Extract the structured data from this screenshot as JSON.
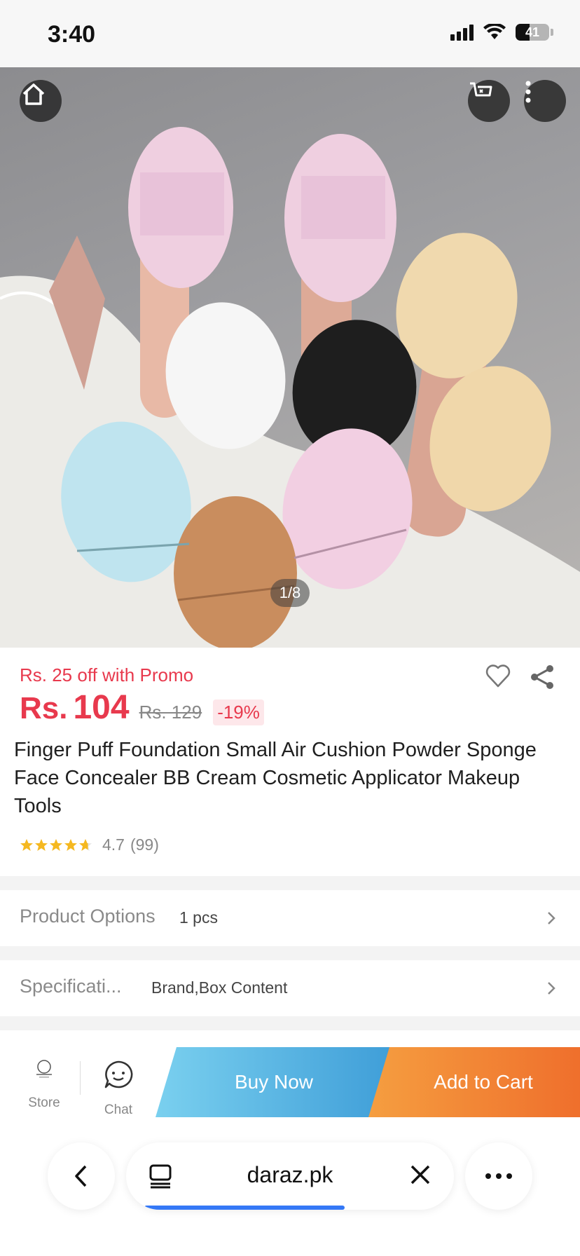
{
  "status_bar": {
    "time": "3:40",
    "battery": "41",
    "battery_level": 0.41
  },
  "product": {
    "image_counter": "1/8",
    "promo": "Rs. 25 off with Promo",
    "price_currency": "Rs.",
    "price": "104",
    "original_price": "Rs. 129",
    "discount": "-19%",
    "title": "Finger Puff Foundation Small Air Cushion Powder Sponge Face Concealer BB Cream Cosmetic Applicator Makeup Tools",
    "rating": 4.7,
    "rating_label": "4.7",
    "review_count": "(99)"
  },
  "options": {
    "label": "Product Options",
    "value": "1 pcs"
  },
  "specifications": {
    "label": "Specificati...",
    "value": "Brand,Box Content"
  },
  "action_bar": {
    "store_label": "Store",
    "chat_label": "Chat",
    "buy_now": "Buy Now",
    "add_to_cart": "Add to Cart"
  },
  "browser": {
    "host": "daraz.pk"
  },
  "colors": {
    "accent_red": "#e8394d",
    "buy_now_blue": "#3f9ed8",
    "add_cart_orange": "#ef6f2c",
    "progress_blue": "#3478f6",
    "star_gold": "#f5b820"
  },
  "icons": [
    "home-icon",
    "cart-icon",
    "more-vertical-icon",
    "heart-icon",
    "share-icon",
    "chevron-right-icon",
    "chat-icon",
    "back-icon",
    "tabs-icon",
    "close-icon",
    "more-horizontal-icon"
  ]
}
